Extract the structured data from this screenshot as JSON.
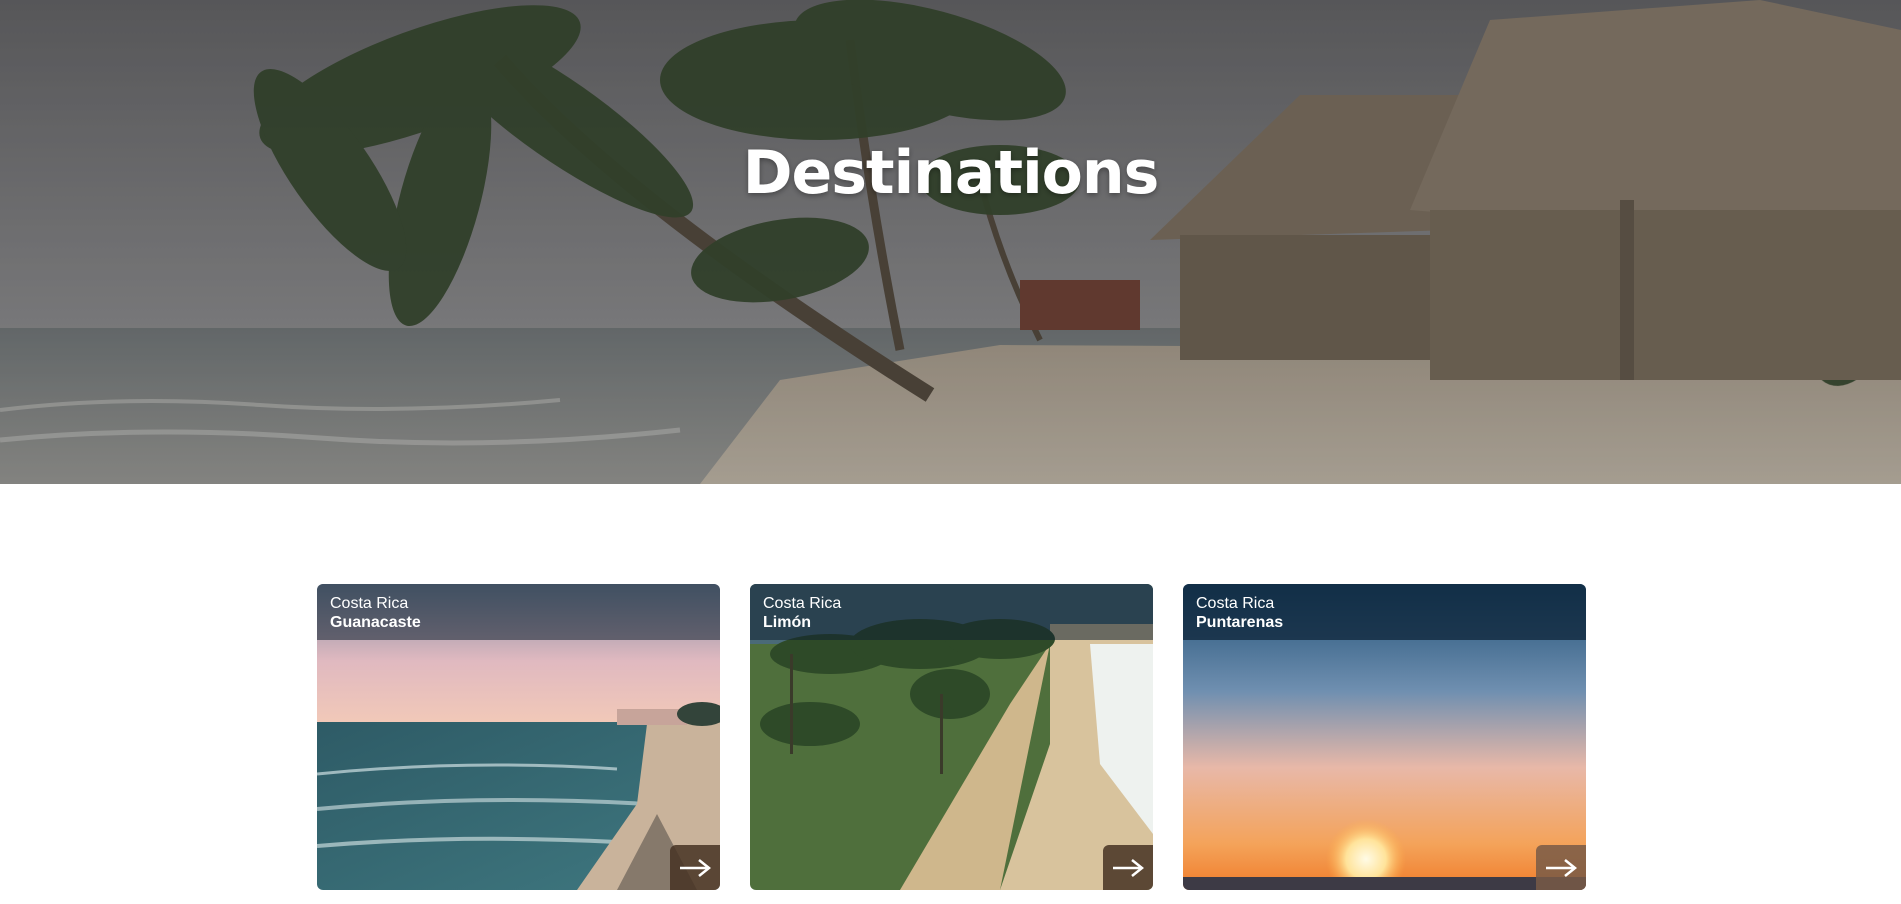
{
  "hero": {
    "title": "Destinations"
  },
  "cards": [
    {
      "country": "Costa Rica",
      "region": "Guanacaste",
      "arrow_icon": "arrow-right-icon"
    },
    {
      "country": "Costa Rica",
      "region": "Limón",
      "arrow_icon": "arrow-right-icon"
    },
    {
      "country": "Costa Rica",
      "region": "Puntarenas",
      "arrow_icon": "arrow-right-icon"
    }
  ],
  "colors": {
    "hero_overlay": "#000000",
    "card_header": "#102030",
    "arrow_button": "#463223",
    "text": "#ffffff"
  }
}
